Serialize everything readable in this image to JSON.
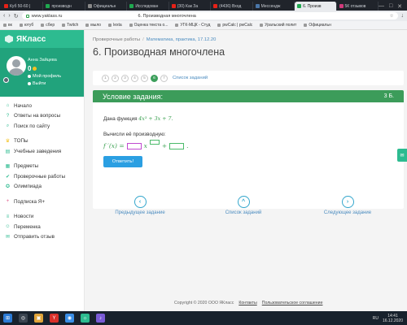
{
  "browser": {
    "tabs": [
      {
        "label": "Куб 50-60 |",
        "kind": "yt"
      },
      {
        "label": "производн",
        "kind": "ya"
      },
      {
        "label": "Официальн",
        "kind": "gr"
      },
      {
        "label": "Исследован",
        "kind": "ya"
      },
      {
        "label": "(30) Как За",
        "kind": "yt"
      },
      {
        "label": "(4436) Вход",
        "kind": "yt"
      },
      {
        "label": "Мессендж",
        "kind": "vk"
      },
      {
        "label": "6. Произв",
        "kind": "ya",
        "active": true
      },
      {
        "label": "5К отзывов",
        "kind": "pi"
      }
    ],
    "url": "www.yaklass.ru",
    "page_title_center": "6. Производная многочлена",
    "window_controls": [
      "—",
      "□",
      "✕"
    ],
    "bookmarks": [
      "вк",
      "ютуб",
      "сбер",
      "Twitch",
      "мыло",
      "lexta",
      "Оценка текста о...",
      "УГК-МЦК - Студ",
      "pwCalc | pwCalc",
      "Уральский полит",
      "Официальн"
    ]
  },
  "sidebar": {
    "logo": "ЯКласс",
    "user_name": "Анна Зайцева",
    "points": "0",
    "links": [
      "Мой профиль",
      "Выйти"
    ],
    "menu_groups": [
      [
        {
          "label": "Начало",
          "icon": "home-icon",
          "glyph": "⌂",
          "color": "#2dbb90"
        },
        {
          "label": "Ответы на вопросы",
          "icon": "question-icon",
          "glyph": "?",
          "color": "#2dbb90"
        },
        {
          "label": "Поиск по сайту",
          "icon": "search-icon",
          "glyph": "⌕",
          "color": "#2dbb90"
        }
      ],
      [
        {
          "label": "ТОПы",
          "icon": "trophy-icon",
          "glyph": "♛",
          "color": "#f3c220"
        },
        {
          "label": "Учебные заведения",
          "icon": "school-icon",
          "glyph": "▤",
          "color": "#2dbb90"
        }
      ],
      [
        {
          "label": "Предметы",
          "icon": "book-icon",
          "glyph": "▦",
          "color": "#2dbb90"
        },
        {
          "label": "Проверочные работы",
          "icon": "check-icon",
          "glyph": "✔",
          "color": "#2dbb90"
        },
        {
          "label": "Олимпиада",
          "icon": "medal-icon",
          "glyph": "✪",
          "color": "#2dbb90"
        }
      ],
      [
        {
          "label": "Подписка Я+",
          "icon": "plus-icon",
          "glyph": "+",
          "color": "#e05a8a"
        }
      ],
      [
        {
          "label": "Новости",
          "icon": "news-icon",
          "glyph": "≡",
          "color": "#2dbb90"
        },
        {
          "label": "Переменка",
          "icon": "break-icon",
          "glyph": "☺",
          "color": "#2dbb90"
        },
        {
          "label": "Отправить отзыв",
          "icon": "feedback-icon",
          "glyph": "✉",
          "color": "#2dbb90"
        }
      ]
    ]
  },
  "main": {
    "breadcrumb": [
      "Проверочные работы",
      "Математика, практика, 17.12.20"
    ],
    "title": "6. Производная многочлена",
    "pages": [
      "1",
      "2",
      "3",
      "4",
      "5",
      "6",
      "7"
    ],
    "current_page": "6",
    "task_list_link": "Список заданий",
    "card": {
      "heading": "Условие задания:",
      "points": "3 Б.",
      "given_label": "Дана функция",
      "given_formula": "4x³ + 3x + 7.",
      "compute_label": "Вычисли её производную:",
      "derivative_prefix": "f ′(x) =",
      "var_x": "x",
      "plus": "+",
      "end_dot": ".",
      "answer_button": "Ответить!"
    },
    "nav_buttons": [
      {
        "label": "Предыдущее задание",
        "glyph": "‹"
      },
      {
        "label": "Список заданий",
        "glyph": "^"
      },
      {
        "label": "Следующее задание",
        "glyph": "›"
      }
    ],
    "footer": {
      "copyright": "Copyright © 2020 ООО ЯКласс",
      "contacts": "Контакты",
      "agreement": "Пользовательское соглашение"
    }
  },
  "taskbar": {
    "apps": [
      "⊞",
      "◎",
      "▣",
      "Y",
      "◉",
      "☼",
      "♪"
    ],
    "lang": "RU",
    "time": "14:41",
    "date": "16.12.2020"
  }
}
